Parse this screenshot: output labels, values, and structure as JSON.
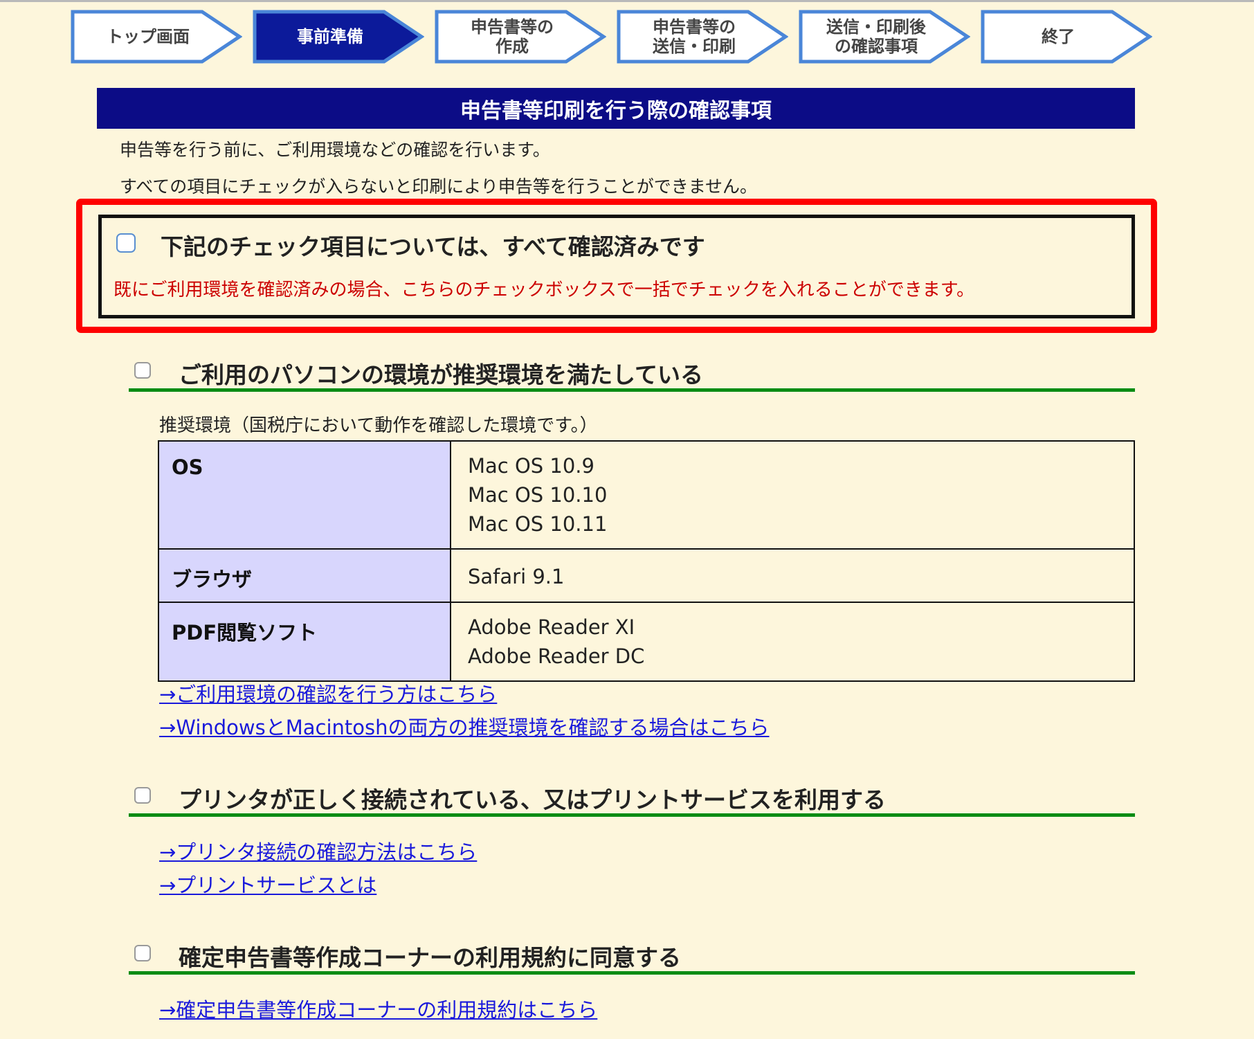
{
  "steps": [
    {
      "label": "トップ画面",
      "active": false
    },
    {
      "label": "事前準備",
      "active": true
    },
    {
      "label": "申告書等の\n作成",
      "active": false
    },
    {
      "label": "申告書等の\n送信・印刷",
      "active": false
    },
    {
      "label": "送信・印刷後\nの確認事項",
      "active": false
    },
    {
      "label": "終了",
      "active": false
    }
  ],
  "title": "申告書等印刷を行う際の確認事項",
  "intro": [
    "申告等を行う前に、ご利用環境などの確認を行います。",
    "すべての項目にチェックが入らないと印刷により申告等を行うことができません。"
  ],
  "master": {
    "label": "下記のチェック項目については、すべて確認済みです",
    "note": "既にご利用環境を確認済みの場合、こちらのチェックボックスで一括でチェックを入れることができます。"
  },
  "sections": [
    {
      "label": "ご利用のパソコンの環境が推奨環境を満たしている"
    },
    {
      "label": "プリンタが正しく接続されている、又はプリントサービスを利用する"
    },
    {
      "label": "確定申告書等作成コーナーの利用規約に同意する"
    }
  ],
  "env": {
    "caption": "推奨環境（国税庁において動作を確認した環境です。）",
    "rows": [
      {
        "head": "OS",
        "values": [
          "Mac OS 10.9",
          "Mac OS 10.10",
          "Mac OS 10.11"
        ]
      },
      {
        "head": "ブラウザ",
        "values": [
          "Safari 9.1"
        ]
      },
      {
        "head": "PDF閲覧ソフト",
        "values": [
          "Adobe Reader XI",
          "Adobe Reader DC"
        ]
      }
    ]
  },
  "links": {
    "env_check": "→ご利用環境の確認を行う方はこちら",
    "env_both": "→WindowsとMacintoshの両方の推奨環境を確認する場合はこちら",
    "printer_check": "→プリンタ接続の確認方法はこちら",
    "print_service": "→プリントサービスとは",
    "terms": "→確定申告書等作成コーナーの利用規約はこちら"
  },
  "colors": {
    "background": "#fdf6dc",
    "title_bar": "#0c0c86",
    "step_active": "#0c1a9a",
    "step_border": "#4a86d8",
    "highlight_red": "#fe0000",
    "rule_green": "#0a8c14",
    "table_head": "#d8d6fd",
    "link": "#1a1adb",
    "note_red": "#cc0000"
  }
}
